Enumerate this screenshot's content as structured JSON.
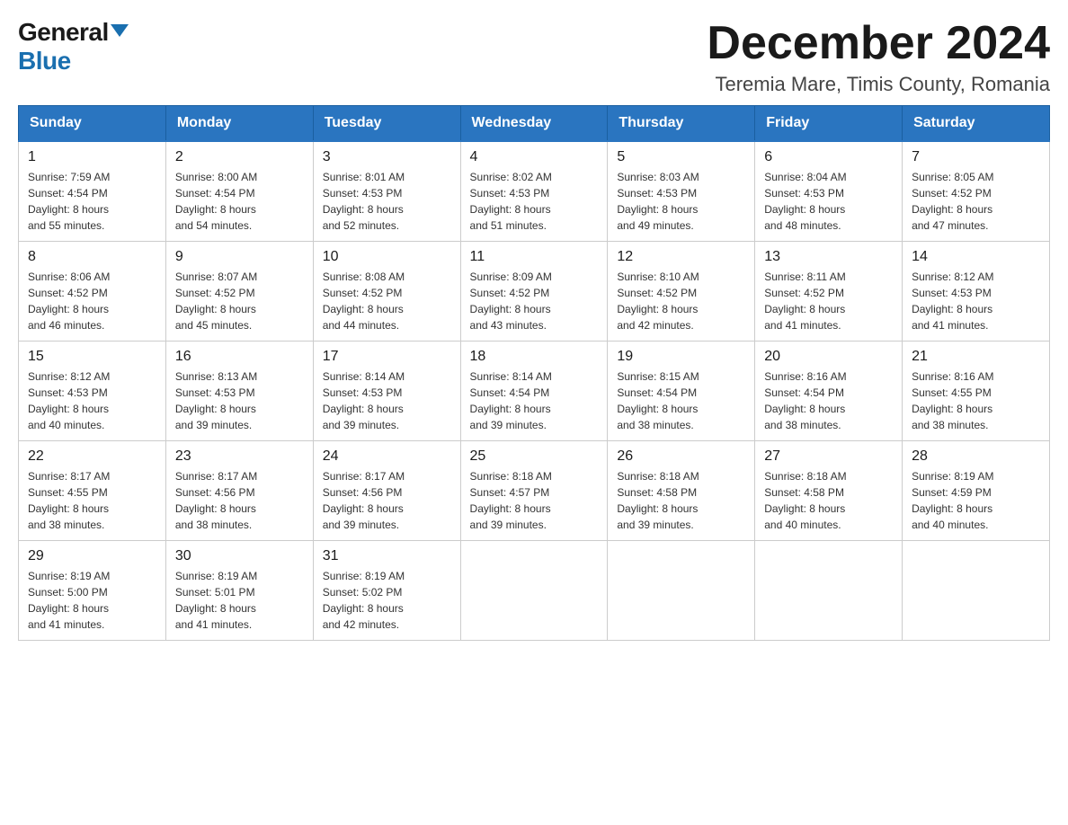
{
  "logo": {
    "general": "General",
    "blue": "Blue"
  },
  "title": {
    "month": "December 2024",
    "location": "Teremia Mare, Timis County, Romania"
  },
  "headers": [
    "Sunday",
    "Monday",
    "Tuesday",
    "Wednesday",
    "Thursday",
    "Friday",
    "Saturday"
  ],
  "weeks": [
    [
      {
        "day": "1",
        "sunrise": "7:59 AM",
        "sunset": "4:54 PM",
        "daylight": "8 hours and 55 minutes."
      },
      {
        "day": "2",
        "sunrise": "8:00 AM",
        "sunset": "4:54 PM",
        "daylight": "8 hours and 54 minutes."
      },
      {
        "day": "3",
        "sunrise": "8:01 AM",
        "sunset": "4:53 PM",
        "daylight": "8 hours and 52 minutes."
      },
      {
        "day": "4",
        "sunrise": "8:02 AM",
        "sunset": "4:53 PM",
        "daylight": "8 hours and 51 minutes."
      },
      {
        "day": "5",
        "sunrise": "8:03 AM",
        "sunset": "4:53 PM",
        "daylight": "8 hours and 49 minutes."
      },
      {
        "day": "6",
        "sunrise": "8:04 AM",
        "sunset": "4:53 PM",
        "daylight": "8 hours and 48 minutes."
      },
      {
        "day": "7",
        "sunrise": "8:05 AM",
        "sunset": "4:52 PM",
        "daylight": "8 hours and 47 minutes."
      }
    ],
    [
      {
        "day": "8",
        "sunrise": "8:06 AM",
        "sunset": "4:52 PM",
        "daylight": "8 hours and 46 minutes."
      },
      {
        "day": "9",
        "sunrise": "8:07 AM",
        "sunset": "4:52 PM",
        "daylight": "8 hours and 45 minutes."
      },
      {
        "day": "10",
        "sunrise": "8:08 AM",
        "sunset": "4:52 PM",
        "daylight": "8 hours and 44 minutes."
      },
      {
        "day": "11",
        "sunrise": "8:09 AM",
        "sunset": "4:52 PM",
        "daylight": "8 hours and 43 minutes."
      },
      {
        "day": "12",
        "sunrise": "8:10 AM",
        "sunset": "4:52 PM",
        "daylight": "8 hours and 42 minutes."
      },
      {
        "day": "13",
        "sunrise": "8:11 AM",
        "sunset": "4:52 PM",
        "daylight": "8 hours and 41 minutes."
      },
      {
        "day": "14",
        "sunrise": "8:12 AM",
        "sunset": "4:53 PM",
        "daylight": "8 hours and 41 minutes."
      }
    ],
    [
      {
        "day": "15",
        "sunrise": "8:12 AM",
        "sunset": "4:53 PM",
        "daylight": "8 hours and 40 minutes."
      },
      {
        "day": "16",
        "sunrise": "8:13 AM",
        "sunset": "4:53 PM",
        "daylight": "8 hours and 39 minutes."
      },
      {
        "day": "17",
        "sunrise": "8:14 AM",
        "sunset": "4:53 PM",
        "daylight": "8 hours and 39 minutes."
      },
      {
        "day": "18",
        "sunrise": "8:14 AM",
        "sunset": "4:54 PM",
        "daylight": "8 hours and 39 minutes."
      },
      {
        "day": "19",
        "sunrise": "8:15 AM",
        "sunset": "4:54 PM",
        "daylight": "8 hours and 38 minutes."
      },
      {
        "day": "20",
        "sunrise": "8:16 AM",
        "sunset": "4:54 PM",
        "daylight": "8 hours and 38 minutes."
      },
      {
        "day": "21",
        "sunrise": "8:16 AM",
        "sunset": "4:55 PM",
        "daylight": "8 hours and 38 minutes."
      }
    ],
    [
      {
        "day": "22",
        "sunrise": "8:17 AM",
        "sunset": "4:55 PM",
        "daylight": "8 hours and 38 minutes."
      },
      {
        "day": "23",
        "sunrise": "8:17 AM",
        "sunset": "4:56 PM",
        "daylight": "8 hours and 38 minutes."
      },
      {
        "day": "24",
        "sunrise": "8:17 AM",
        "sunset": "4:56 PM",
        "daylight": "8 hours and 39 minutes."
      },
      {
        "day": "25",
        "sunrise": "8:18 AM",
        "sunset": "4:57 PM",
        "daylight": "8 hours and 39 minutes."
      },
      {
        "day": "26",
        "sunrise": "8:18 AM",
        "sunset": "4:58 PM",
        "daylight": "8 hours and 39 minutes."
      },
      {
        "day": "27",
        "sunrise": "8:18 AM",
        "sunset": "4:58 PM",
        "daylight": "8 hours and 40 minutes."
      },
      {
        "day": "28",
        "sunrise": "8:19 AM",
        "sunset": "4:59 PM",
        "daylight": "8 hours and 40 minutes."
      }
    ],
    [
      {
        "day": "29",
        "sunrise": "8:19 AM",
        "sunset": "5:00 PM",
        "daylight": "8 hours and 41 minutes."
      },
      {
        "day": "30",
        "sunrise": "8:19 AM",
        "sunset": "5:01 PM",
        "daylight": "8 hours and 41 minutes."
      },
      {
        "day": "31",
        "sunrise": "8:19 AM",
        "sunset": "5:02 PM",
        "daylight": "8 hours and 42 minutes."
      },
      null,
      null,
      null,
      null
    ]
  ],
  "labels": {
    "sunrise": "Sunrise:",
    "sunset": "Sunset:",
    "daylight": "Daylight:"
  }
}
